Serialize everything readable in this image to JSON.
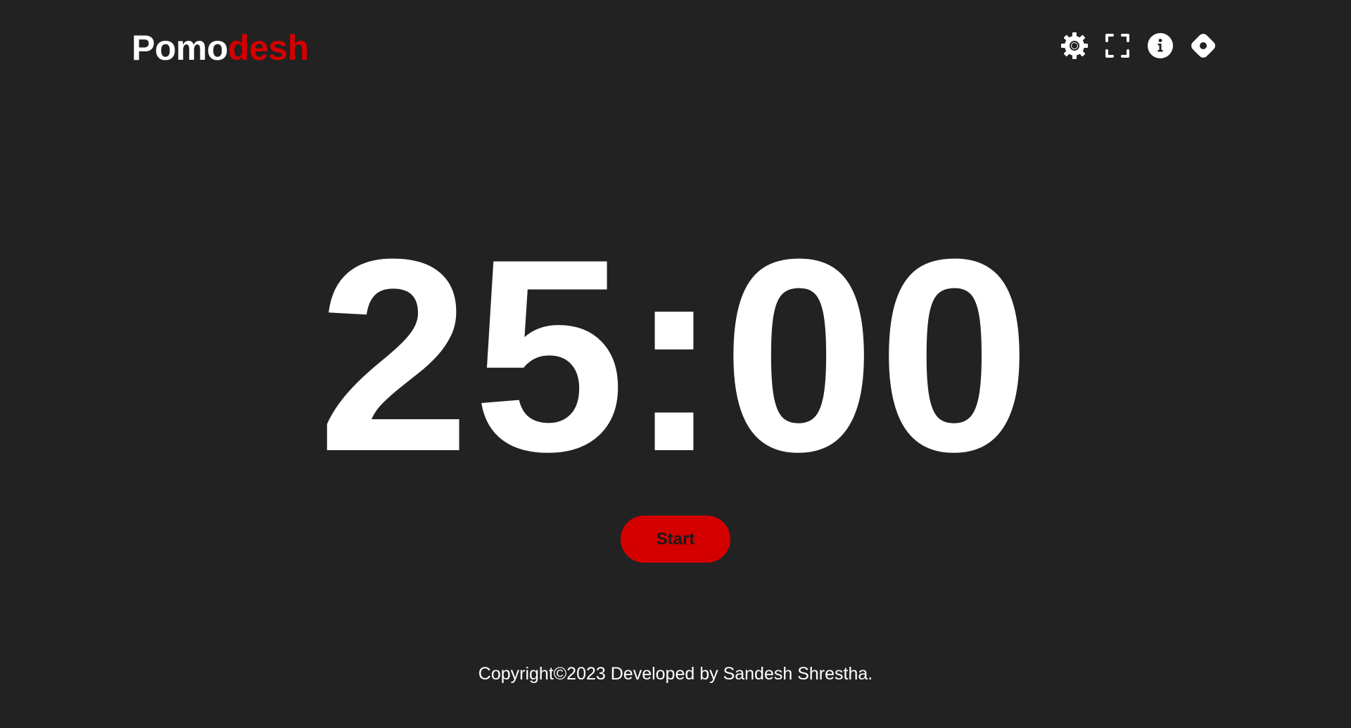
{
  "header": {
    "logo_part1": "Pomo",
    "logo_part2": "desh",
    "icons": [
      "settings-icon",
      "fullscreen-icon",
      "info-icon",
      "tips-icon"
    ]
  },
  "timer": {
    "display": "25:00"
  },
  "controls": {
    "start_label": "Start"
  },
  "footer": {
    "text": "Copyright©2023 Developed by Sandesh Shrestha."
  },
  "colors": {
    "background": "#222222",
    "accent": "#d40000",
    "text": "#ffffff"
  }
}
